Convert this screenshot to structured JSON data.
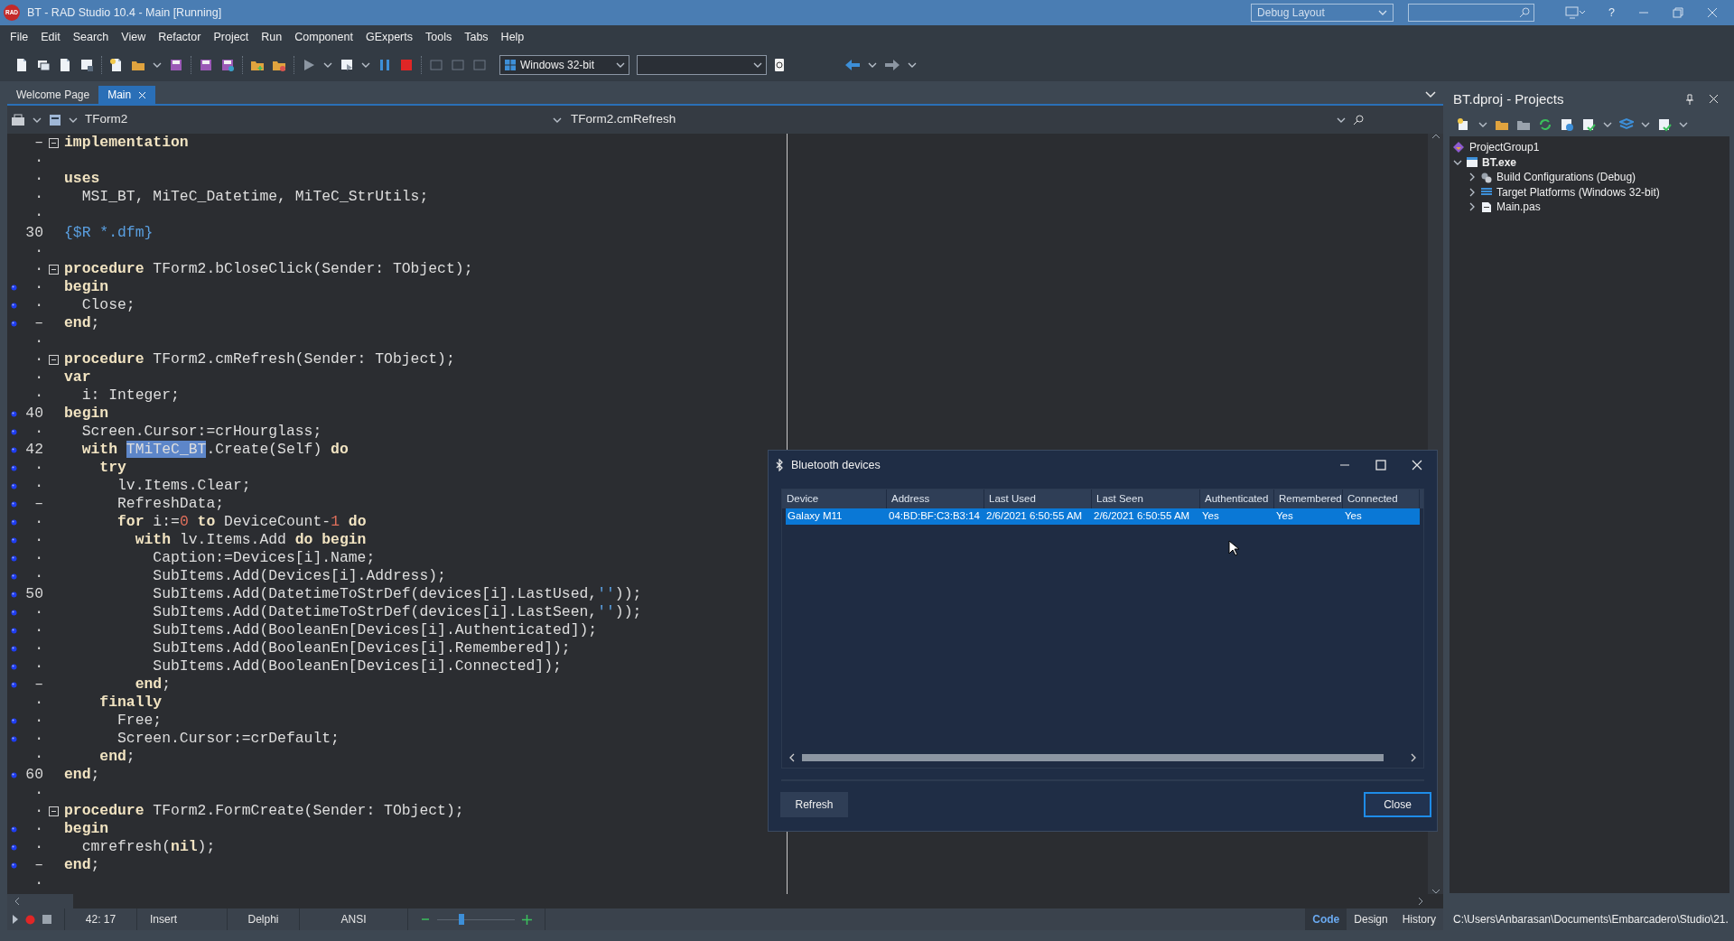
{
  "window": {
    "logo": "RAD",
    "title": "BT - RAD Studio 10.4 - Main [Running]",
    "layout": "Debug Layout",
    "help": "?"
  },
  "menu": [
    "File",
    "Edit",
    "Search",
    "View",
    "Refactor",
    "Project",
    "Run",
    "Component",
    "GExperts",
    "Tools",
    "Tabs",
    "Help"
  ],
  "toolbar": {
    "platform": "Windows 32-bit"
  },
  "tabs": [
    {
      "label": "Welcome Page",
      "selected": false,
      "closable": false
    },
    {
      "label": "Main",
      "selected": true,
      "closable": true
    }
  ],
  "editor": {
    "class_combo": "TForm2",
    "method_combo": "TForm2.cmRefresh",
    "lines": [
      {
        "gutter": "–",
        "breakpoint": false,
        "fold": true,
        "code": [
          {
            "kind": "kw",
            "text": "implementation"
          }
        ]
      },
      {
        "gutter": "·",
        "breakpoint": false,
        "fold": false
      },
      {
        "gutter": "·",
        "breakpoint": false,
        "fold": false,
        "code": [
          {
            "kind": "kw",
            "text": "uses"
          }
        ]
      },
      {
        "gutter": "·",
        "breakpoint": false,
        "fold": false,
        "code": [
          {
            "kind": "id",
            "text": "  MSI_BT, MiTeC_Datetime, MiTeC_StrUtils;"
          }
        ]
      },
      {
        "gutter": "·",
        "breakpoint": false,
        "fold": false
      },
      {
        "gutter": "30",
        "breakpoint": false,
        "fold": false,
        "code": [
          {
            "kind": "dir",
            "text": "{$R *.dfm}"
          }
        ]
      },
      {
        "gutter": "·",
        "breakpoint": false,
        "fold": false
      },
      {
        "gutter": "·",
        "breakpoint": false,
        "fold": true,
        "code": [
          {
            "kind": "kw",
            "text": "procedure"
          },
          {
            "kind": "id",
            "text": " TForm2.bCloseClick(Sender: TObject);"
          }
        ]
      },
      {
        "gutter": "·",
        "breakpoint": true,
        "fold": false,
        "code": [
          {
            "kind": "kw",
            "text": "begin"
          }
        ]
      },
      {
        "gutter": "·",
        "breakpoint": true,
        "fold": false,
        "code": [
          {
            "kind": "id",
            "text": "  Close;"
          }
        ]
      },
      {
        "gutter": "–",
        "breakpoint": true,
        "fold": false,
        "code": [
          {
            "kind": "kw",
            "text": "end"
          },
          {
            "kind": "id",
            "text": ";"
          }
        ]
      },
      {
        "gutter": "·",
        "breakpoint": false,
        "fold": false
      },
      {
        "gutter": "·",
        "breakpoint": false,
        "fold": true,
        "code": [
          {
            "kind": "kw",
            "text": "procedure"
          },
          {
            "kind": "id",
            "text": " TForm2.cmRefresh(Sender: TObject);"
          }
        ]
      },
      {
        "gutter": "·",
        "breakpoint": false,
        "fold": false,
        "code": [
          {
            "kind": "kw",
            "text": "var"
          }
        ]
      },
      {
        "gutter": "·",
        "breakpoint": false,
        "fold": false,
        "code": [
          {
            "kind": "id",
            "text": "  i: Integer;"
          }
        ]
      },
      {
        "gutter": "40",
        "breakpoint": true,
        "fold": false,
        "code": [
          {
            "kind": "kw",
            "text": "begin"
          }
        ]
      },
      {
        "gutter": "·",
        "breakpoint": true,
        "fold": false,
        "code": [
          {
            "kind": "id",
            "text": "  Screen.Cursor:=crHourglass;"
          }
        ]
      },
      {
        "gutter": "42",
        "breakpoint": true,
        "fold": false,
        "code": [
          {
            "kind": "kw",
            "text": "  with "
          },
          {
            "kind": "sel",
            "text": "TMiTeC_BT"
          },
          {
            "kind": "id",
            "text": ".Create(Self) "
          },
          {
            "kind": "kw",
            "text": "do"
          }
        ]
      },
      {
        "gutter": "·",
        "breakpoint": true,
        "fold": false,
        "code": [
          {
            "kind": "kw",
            "text": "    try"
          }
        ]
      },
      {
        "gutter": "·",
        "breakpoint": true,
        "fold": false,
        "code": [
          {
            "kind": "id",
            "text": "      lv.Items.Clear;"
          }
        ]
      },
      {
        "gutter": "–",
        "breakpoint": true,
        "fold": false,
        "code": [
          {
            "kind": "id",
            "text": "      RefreshData;"
          }
        ]
      },
      {
        "gutter": "·",
        "breakpoint": true,
        "fold": false,
        "code": [
          {
            "kind": "kw",
            "text": "      for"
          },
          {
            "kind": "id",
            "text": " i:="
          },
          {
            "kind": "num",
            "text": "0"
          },
          {
            "kind": "kw",
            "text": " to"
          },
          {
            "kind": "id",
            "text": " DeviceCount-"
          },
          {
            "kind": "num",
            "text": "1"
          },
          {
            "kind": "kw",
            "text": " do"
          }
        ]
      },
      {
        "gutter": "·",
        "breakpoint": true,
        "fold": false,
        "code": [
          {
            "kind": "kw",
            "text": "        with"
          },
          {
            "kind": "id",
            "text": " lv.Items.Add "
          },
          {
            "kind": "kw",
            "text": "do begin"
          }
        ]
      },
      {
        "gutter": "·",
        "breakpoint": true,
        "fold": false,
        "code": [
          {
            "kind": "id",
            "text": "          Caption:=Devices[i].Name;"
          }
        ]
      },
      {
        "gutter": "·",
        "breakpoint": true,
        "fold": false,
        "code": [
          {
            "kind": "id",
            "text": "          SubItems.Add(Devices[i].Address);"
          }
        ]
      },
      {
        "gutter": "50",
        "breakpoint": true,
        "fold": false,
        "code": [
          {
            "kind": "id",
            "text": "          SubItems.Add(DatetimeToStrDef(devices[i].LastUsed,"
          },
          {
            "kind": "str",
            "text": "''"
          },
          {
            "kind": "id",
            "text": "));"
          }
        ]
      },
      {
        "gutter": "·",
        "breakpoint": true,
        "fold": false,
        "code": [
          {
            "kind": "id",
            "text": "          SubItems.Add(DatetimeToStrDef(devices[i].LastSeen,"
          },
          {
            "kind": "str",
            "text": "''"
          },
          {
            "kind": "id",
            "text": "));"
          }
        ]
      },
      {
        "gutter": "·",
        "breakpoint": true,
        "fold": false,
        "code": [
          {
            "kind": "id",
            "text": "          SubItems.Add(BooleanEn[Devices[i].Authenticated]);"
          }
        ]
      },
      {
        "gutter": "·",
        "breakpoint": true,
        "fold": false,
        "code": [
          {
            "kind": "id",
            "text": "          SubItems.Add(BooleanEn[Devices[i].Remembered]);"
          }
        ]
      },
      {
        "gutter": "·",
        "breakpoint": true,
        "fold": false,
        "code": [
          {
            "kind": "id",
            "text": "          SubItems.Add(BooleanEn[Devices[i].Connected]);"
          }
        ]
      },
      {
        "gutter": "–",
        "breakpoint": true,
        "fold": false,
        "code": [
          {
            "kind": "kw",
            "text": "        end"
          },
          {
            "kind": "id",
            "text": ";"
          }
        ]
      },
      {
        "gutter": "·",
        "breakpoint": false,
        "fold": false,
        "code": [
          {
            "kind": "kw",
            "text": "    finally"
          }
        ]
      },
      {
        "gutter": "·",
        "breakpoint": true,
        "fold": false,
        "code": [
          {
            "kind": "id",
            "text": "      Free;"
          }
        ]
      },
      {
        "gutter": "·",
        "breakpoint": true,
        "fold": false,
        "code": [
          {
            "kind": "id",
            "text": "      Screen.Cursor:=crDefault;"
          }
        ]
      },
      {
        "gutter": "·",
        "breakpoint": false,
        "fold": false,
        "code": [
          {
            "kind": "kw",
            "text": "    end"
          },
          {
            "kind": "id",
            "text": ";"
          }
        ]
      },
      {
        "gutter": "60",
        "breakpoint": true,
        "fold": false,
        "code": [
          {
            "kind": "kw",
            "text": "end"
          },
          {
            "kind": "id",
            "text": ";"
          }
        ]
      },
      {
        "gutter": "·",
        "breakpoint": false,
        "fold": false
      },
      {
        "gutter": "·",
        "breakpoint": false,
        "fold": true,
        "code": [
          {
            "kind": "kw",
            "text": "procedure"
          },
          {
            "kind": "id",
            "text": " TForm2.FormCreate(Sender: TObject);"
          }
        ]
      },
      {
        "gutter": "·",
        "breakpoint": true,
        "fold": false,
        "code": [
          {
            "kind": "kw",
            "text": "begin"
          }
        ]
      },
      {
        "gutter": "·",
        "breakpoint": true,
        "fold": false,
        "code": [
          {
            "kind": "id",
            "text": "  cmrefresh("
          },
          {
            "kind": "kw",
            "text": "nil"
          },
          {
            "kind": "id",
            "text": ");"
          }
        ]
      },
      {
        "gutter": "–",
        "breakpoint": true,
        "fold": false,
        "code": [
          {
            "kind": "kw",
            "text": "end"
          },
          {
            "kind": "id",
            "text": ";"
          }
        ]
      },
      {
        "gutter": "·",
        "breakpoint": false,
        "fold": false
      }
    ],
    "status": {
      "position": "42: 17",
      "mode": "Insert",
      "language": "Delphi",
      "encoding": "ANSI",
      "zoom": {
        "level": 0.3
      }
    },
    "view_tabs": [
      {
        "label": "Code",
        "selected": true
      },
      {
        "label": "Design",
        "selected": false
      },
      {
        "label": "History",
        "selected": false
      }
    ]
  },
  "dialog": {
    "title": "Bluetooth devices",
    "columns": [
      "Device",
      "Address",
      "Last Used",
      "Last Seen",
      "Authenticated",
      "Remembered",
      "Connected"
    ],
    "rows": [
      {
        "cells": [
          "Galaxy M11",
          "04:BD:BF:C3:B3:14",
          "2/6/2021 6:50:55 AM",
          "2/6/2021 6:50:55 AM",
          "Yes",
          "Yes",
          "Yes"
        ],
        "selected": true
      }
    ],
    "buttons": [
      {
        "label": "Refresh",
        "default": false
      },
      {
        "label": "Close",
        "default": true
      }
    ]
  },
  "projects": {
    "title": "BT.dproj - Projects",
    "tree": [
      {
        "label": "ProjectGroup1",
        "kind": "group",
        "active": false,
        "children": [
          {
            "label": "BT.exe",
            "kind": "exe",
            "active": true,
            "expanded": true,
            "children": [
              {
                "label": "Build Configurations (Debug)",
                "kind": "config",
                "active": false,
                "expanded": false
              },
              {
                "label": "Target Platforms (Windows 32-bit)",
                "kind": "platforms",
                "active": false,
                "expanded": false
              },
              {
                "label": "Main.pas",
                "kind": "file",
                "active": false,
                "expanded": false
              }
            ]
          }
        ]
      }
    ],
    "path": "C:\\Users\\Anbarasan\\Documents\\Embarcadero\\Studio\\21."
  }
}
